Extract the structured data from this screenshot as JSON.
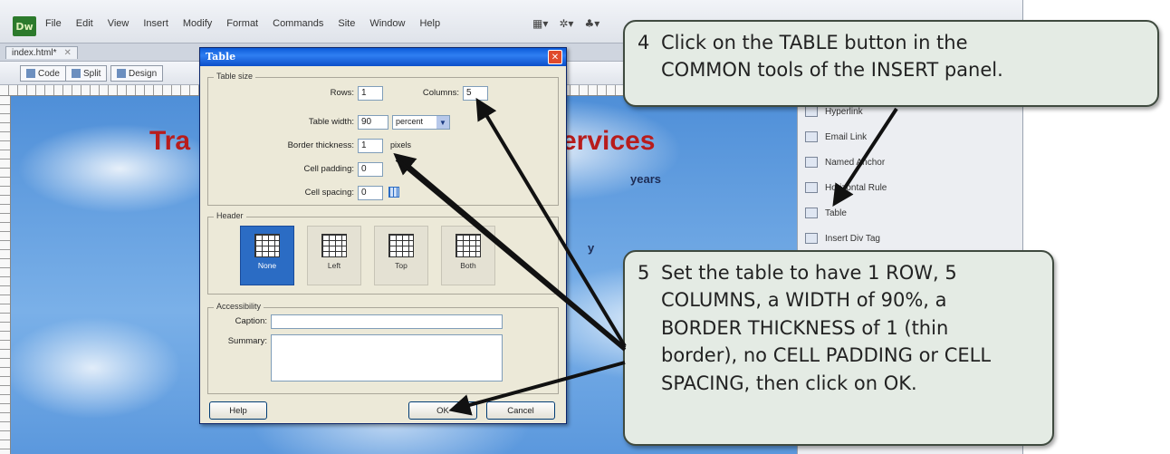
{
  "app": {
    "logo": "Dw",
    "menu": [
      "File",
      "Edit",
      "View",
      "Insert",
      "Modify",
      "Format",
      "Commands",
      "Site",
      "Window",
      "Help"
    ],
    "toolbar_icons": [
      "layout-icon",
      "extend-icon",
      "site-icon"
    ]
  },
  "document": {
    "tab_label": "index.html*",
    "view_buttons": [
      "Code",
      "Split",
      "Design"
    ],
    "heading_left": "Tra",
    "heading_right": "ervices",
    "line_years": "years",
    "line_stray": "y"
  },
  "insert_panel": {
    "items": [
      "Hyperlink",
      "Email Link",
      "Named Anchor",
      "Horizontal Rule",
      "Table",
      "Insert Div Tag"
    ]
  },
  "dialog": {
    "title": "Table",
    "group_table_size": "Table size",
    "rows_label": "Rows:",
    "rows_value": "1",
    "columns_label": "Columns:",
    "columns_value": "5",
    "width_label": "Table width:",
    "width_value": "90",
    "width_unit": "percent",
    "border_label": "Border thickness:",
    "border_value": "1",
    "border_unit": "pixels",
    "padding_label": "Cell padding:",
    "padding_value": "0",
    "spacing_label": "Cell spacing:",
    "spacing_value": "0",
    "group_header": "Header",
    "header_options": [
      "None",
      "Left",
      "Top",
      "Both"
    ],
    "header_selected": "None",
    "group_accessibility": "Accessibility",
    "caption_label": "Caption:",
    "summary_label": "Summary:",
    "help_button": "Help",
    "ok_button": "OK",
    "cancel_button": "Cancel"
  },
  "callouts": {
    "step4_num": "4",
    "step4_text_line1": "Click on the TABLE button in the",
    "step4_text_line2": "COMMON tools of the INSERT panel.",
    "step5_num": "5",
    "step5_lines": [
      "Set the table to have 1 ROW, 5",
      "COLUMNS, a WIDTH of 90%, a",
      "BORDER THICKNESS of 1 (thin",
      "border),  no CELL PADDING or CELL",
      "SPACING, then click on OK."
    ]
  }
}
